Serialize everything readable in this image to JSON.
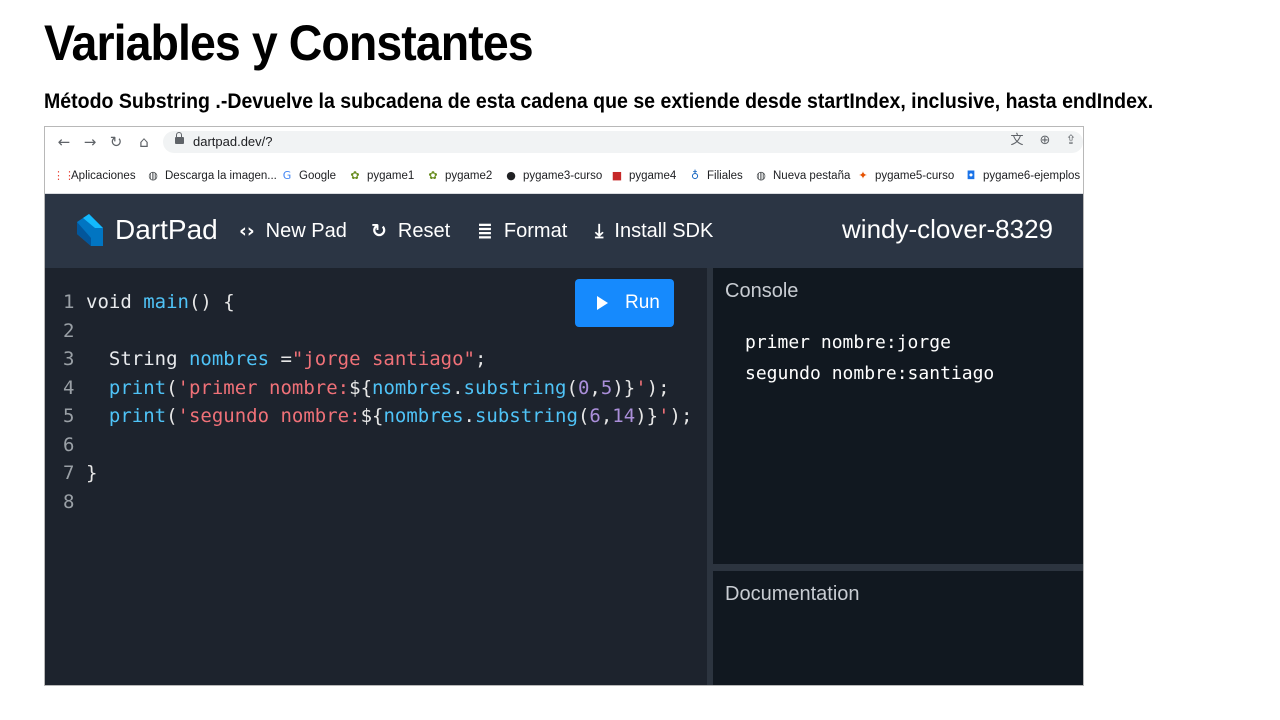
{
  "slide": {
    "title": "Variables y Constantes",
    "subtitle": "Método Substring .-Devuelve la subcadena de esta cadena que se extiende desde startIndex, inclusive, hasta endIndex."
  },
  "browser": {
    "url": "dartpad.dev/?",
    "bookmarks": [
      {
        "label": "Aplicaciones",
        "icon": "apps-grid-icon",
        "color": "#ea4335"
      },
      {
        "label": "Descarga la imagen...",
        "icon": "globe-icon",
        "color": "#3c4043"
      },
      {
        "label": "Google",
        "icon": "google-icon",
        "color": "#4285f4"
      },
      {
        "label": "pygame1",
        "icon": "pygame-icon",
        "color": "#6b8e23"
      },
      {
        "label": "pygame2",
        "icon": "pygame-icon",
        "color": "#6b8e23"
      },
      {
        "label": "pygame3-curso",
        "icon": "dark-circle-icon",
        "color": "#202124"
      },
      {
        "label": "pygame4",
        "icon": "squares-icon",
        "color": "#c62828"
      },
      {
        "label": "Filiales",
        "icon": "emblem-icon",
        "color": "#1565c0"
      },
      {
        "label": "Nueva pestaña",
        "icon": "globe-icon",
        "color": "#3c4043"
      },
      {
        "label": "pygame5-curso",
        "icon": "fox-icon",
        "color": "#e65100"
      },
      {
        "label": "pygame6-ejemplos",
        "icon": "shield-icon",
        "color": "#1a73e8"
      }
    ]
  },
  "dartpad": {
    "brand": "DartPad",
    "buttons": [
      {
        "label": "New Pad",
        "icon": "code-brackets-icon"
      },
      {
        "label": "Reset",
        "icon": "refresh-icon"
      },
      {
        "label": "Format",
        "icon": "align-lines-icon"
      },
      {
        "label": "Install SDK",
        "icon": "download-icon"
      }
    ],
    "pad_name": "windy-clover-8329",
    "run_label": "Run",
    "console_title": "Console",
    "docs_title": "Documentation",
    "console_output": [
      "primer nombre:jorge",
      "segundo nombre:santiago"
    ],
    "code_lines": [
      {
        "n": "1",
        "parts": [
          [
            "void ",
            "kw"
          ],
          [
            "main",
            "fn"
          ],
          [
            "() {",
            "plain"
          ]
        ]
      },
      {
        "n": "2",
        "parts": []
      },
      {
        "n": "3",
        "parts": [
          [
            "  String ",
            "kw"
          ],
          [
            "nombres",
            "fn"
          ],
          [
            " =",
            "plain"
          ],
          [
            "\"jorge santiago\"",
            "str"
          ],
          [
            ";",
            "plain"
          ]
        ]
      },
      {
        "n": "4",
        "parts": [
          [
            "  print",
            "fn"
          ],
          [
            "(",
            "plain"
          ],
          [
            "'primer nombre:",
            "str"
          ],
          [
            "${",
            "plain"
          ],
          [
            "nombres",
            "fn"
          ],
          [
            ".",
            "plain"
          ],
          [
            "substring",
            "fn"
          ],
          [
            "(",
            "plain"
          ],
          [
            "0",
            "num"
          ],
          [
            ",",
            "plain"
          ],
          [
            "5",
            "num"
          ],
          [
            ")}",
            "plain"
          ],
          [
            "'",
            "str"
          ],
          [
            ");",
            "plain"
          ]
        ]
      },
      {
        "n": "5",
        "parts": [
          [
            "  print",
            "fn"
          ],
          [
            "(",
            "plain"
          ],
          [
            "'segundo nombre:",
            "str"
          ],
          [
            "${",
            "plain"
          ],
          [
            "nombres",
            "fn"
          ],
          [
            ".",
            "plain"
          ],
          [
            "substring",
            "fn"
          ],
          [
            "(",
            "plain"
          ],
          [
            "6",
            "num"
          ],
          [
            ",",
            "plain"
          ],
          [
            "14",
            "num"
          ],
          [
            ")}",
            "plain"
          ],
          [
            "'",
            "str"
          ],
          [
            ");",
            "plain"
          ]
        ]
      },
      {
        "n": "6",
        "parts": []
      },
      {
        "n": "7",
        "parts": [
          [
            "}",
            "plain"
          ]
        ]
      },
      {
        "n": "8",
        "parts": []
      }
    ]
  },
  "colors": {
    "header_bg": "#2b3544",
    "editor_bg": "#1d232d",
    "console_bg": "#111820",
    "run_button": "#168afd"
  }
}
